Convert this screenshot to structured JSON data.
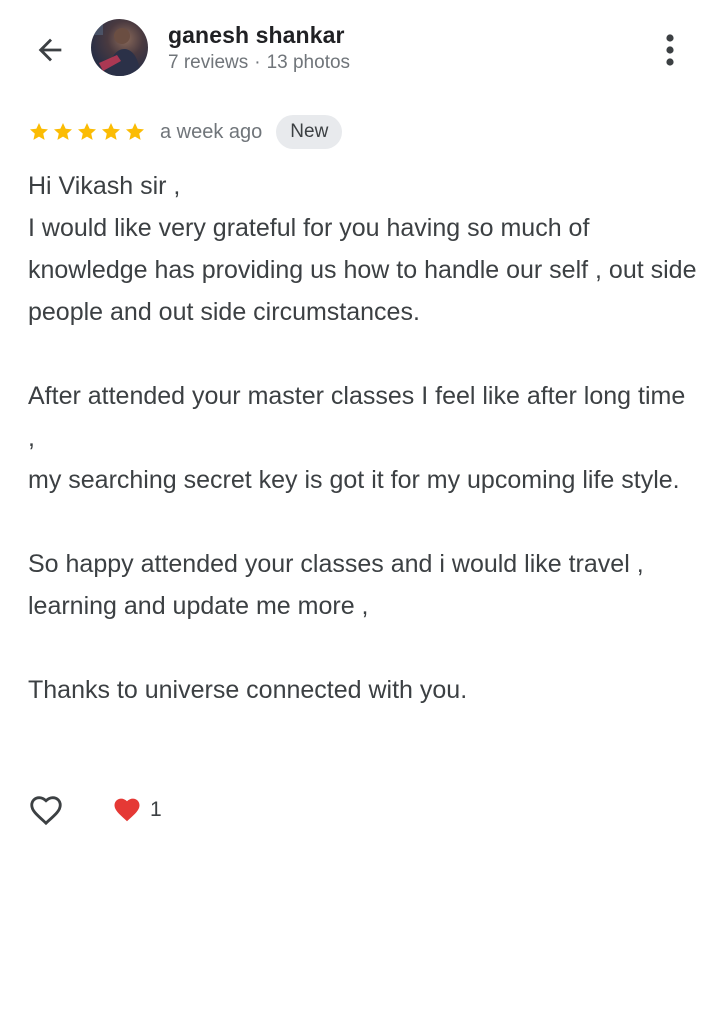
{
  "header": {
    "author_name": "ganesh shankar",
    "reviews_count": "7 reviews",
    "separator": "·",
    "photos_count": "13 photos",
    "back_icon": "arrow-left-icon",
    "more_icon": "more-vert-icon"
  },
  "review": {
    "rating": 5,
    "rating_max": 5,
    "star_color": "#fbbc04",
    "time": "a week ago",
    "badge": "New",
    "paragraphs": [
      [
        "Hi Vikash sir ,",
        "I would like very grateful for you having so much of knowledge has providing us how to handle our self , out side people and out side circumstances."
      ],
      [
        "After attended your master classes I feel like after long time ,",
        "my searching secret key is got it for my upcoming life style."
      ],
      [
        "So happy attended your classes and i would like travel , learning and update me more ,"
      ],
      [
        "Thanks to universe connected with you."
      ]
    ]
  },
  "reactions": {
    "like_icon": "heart-outline-icon",
    "reaction_icon": "red-heart-icon",
    "reaction_color": "#e53935",
    "count": "1"
  }
}
